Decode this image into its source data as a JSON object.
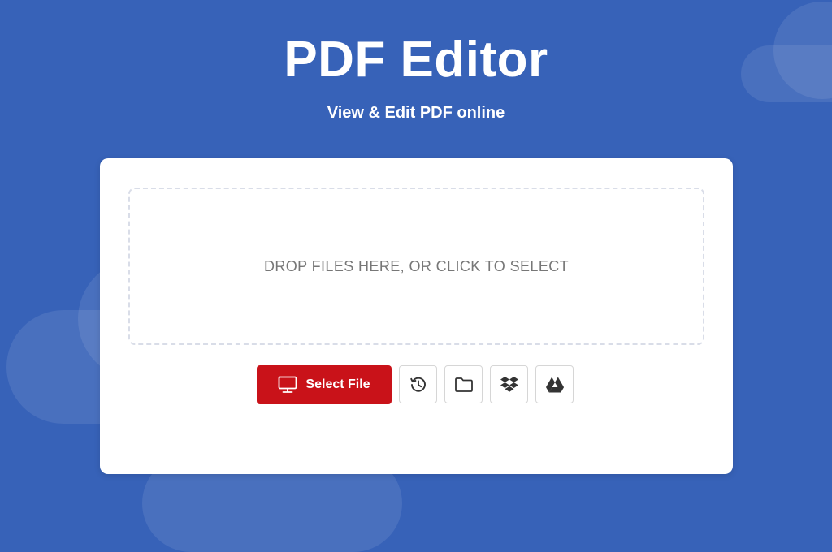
{
  "header": {
    "title": "PDF Editor",
    "subtitle": "View & Edit PDF online"
  },
  "upload": {
    "drop_text": "DROP FILES HERE, OR CLICK TO SELECT",
    "select_label": "Select File",
    "icons": {
      "select": "monitor-icon",
      "recent": "history-icon",
      "browse": "folder-icon",
      "dropbox": "dropbox-icon",
      "drive": "google-drive-icon"
    }
  },
  "colors": {
    "background": "#3762b8",
    "select_button": "#c91219"
  }
}
